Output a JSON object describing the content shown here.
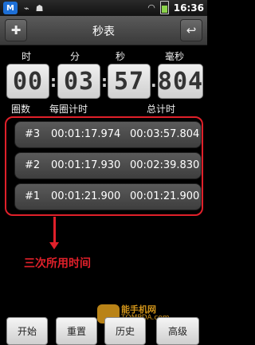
{
  "status_bar": {
    "app_badge": "M",
    "time": "16:36",
    "icons": [
      "usb-icon",
      "android-icon",
      "wifi-icon",
      "battery-icon"
    ]
  },
  "title_bar": {
    "title": "秒表",
    "left_icon": "tools-icon",
    "right_icon": "back-icon"
  },
  "clock": {
    "labels": [
      "时",
      "分",
      "秒",
      "毫秒"
    ],
    "digits": [
      "00",
      "03",
      "57",
      "804"
    ]
  },
  "lap_headers": [
    "圈数",
    "每圈计时",
    "总计时"
  ],
  "laps": [
    {
      "index": "#3",
      "lap": "00:01:17.974",
      "total": "00:03:57.804"
    },
    {
      "index": "#2",
      "lap": "00:01:17.930",
      "total": "00:02:39.830"
    },
    {
      "index": "#1",
      "lap": "00:01:21.900",
      "total": "00:01:21.900"
    }
  ],
  "annotation": "三次所用时间",
  "watermark": {
    "text": "能手机网",
    "url": "TOMPDA.com"
  },
  "buttons": [
    "开始",
    "重置",
    "历史",
    "高级"
  ],
  "colors": {
    "accent_red": "#e0202a",
    "watermark": "#e7a41d"
  }
}
